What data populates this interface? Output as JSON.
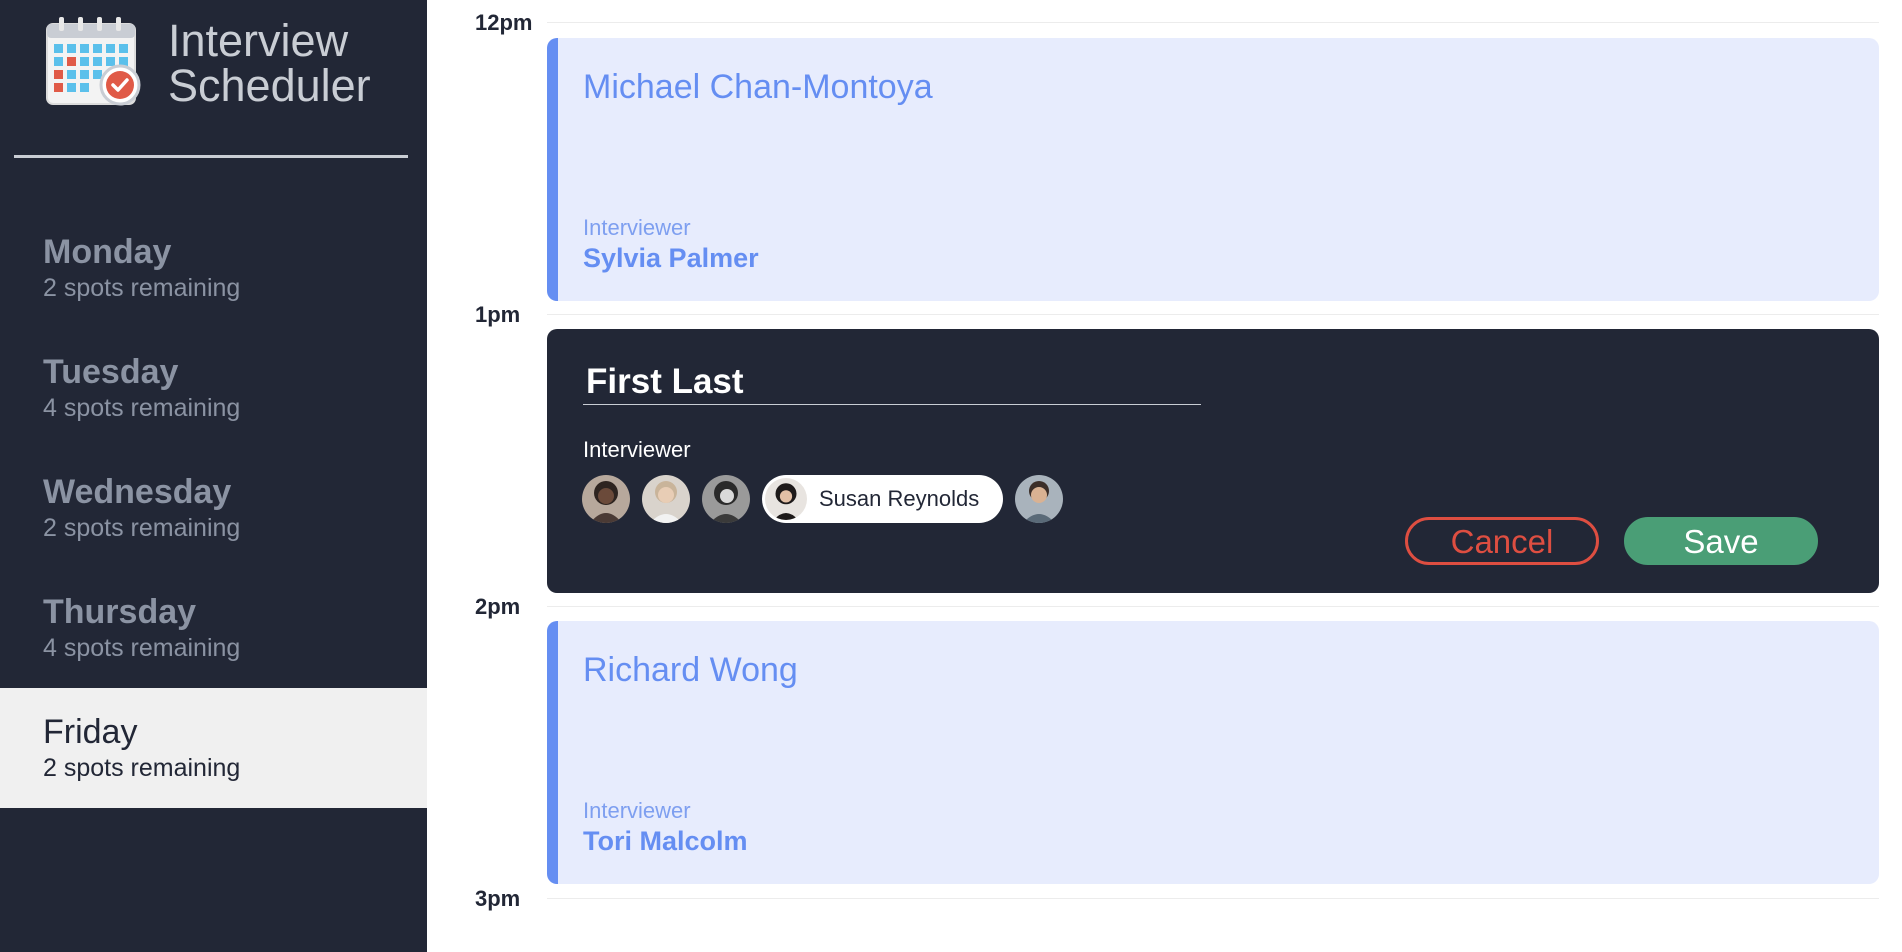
{
  "app": {
    "title_line1": "Interview",
    "title_line2": "Scheduler"
  },
  "sidebar": {
    "days": [
      {
        "name": "Monday",
        "spots": "2 spots remaining"
      },
      {
        "name": "Tuesday",
        "spots": "4 spots remaining"
      },
      {
        "name": "Wednesday",
        "spots": "2 spots remaining"
      },
      {
        "name": "Thursday",
        "spots": "4 spots remaining"
      },
      {
        "name": "Friday",
        "spots": "2 spots remaining",
        "selected": true
      }
    ]
  },
  "schedule": {
    "times": [
      "12pm",
      "1pm",
      "2pm",
      "3pm"
    ],
    "appointments": [
      {
        "student": "Michael Chan-Montoya",
        "interviewer_label": "Interviewer",
        "interviewer": "Sylvia Palmer"
      },
      {
        "student": "Richard Wong",
        "interviewer_label": "Interviewer",
        "interviewer": "Tori Malcolm"
      }
    ],
    "form": {
      "name_placeholder": "First Last",
      "interviewer_label": "Interviewer",
      "selected_interviewer": "Susan Reynolds",
      "cancel_label": "Cancel",
      "save_label": "Save"
    }
  },
  "colors": {
    "sidebar_bg": "#222736",
    "appointment_bg": "#e7ecfd",
    "appointment_accent": "#658ef2",
    "cancel": "#de4e41",
    "save": "#4a9e76"
  }
}
